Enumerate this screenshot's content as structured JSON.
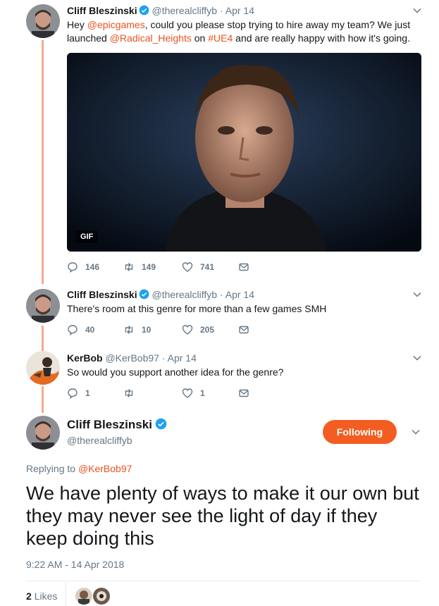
{
  "tweet1": {
    "name": "Cliff Bleszinski",
    "handle": "@therealcliffyb",
    "time": "Apr 14",
    "text_pre": "Hey ",
    "mention1": "@epicgames",
    "text_mid1": ", could you please stop trying to hire away my team? We just launched ",
    "mention2": "@Radical_Heights",
    "text_mid2": " on ",
    "hashtag": "#UE4",
    "text_post": " and are really happy with how it's going.",
    "media_badge": "GIF",
    "replies": "146",
    "retweets": "149",
    "likes": "741"
  },
  "tweet2": {
    "name": "Cliff Bleszinski",
    "handle": "@therealcliffyb",
    "time": "Apr 14",
    "text": "There's room at this genre for more than a few games SMH",
    "replies": "40",
    "retweets": "10",
    "likes": "205"
  },
  "tweet3": {
    "name": "KerBob",
    "handle": "@KerBob97",
    "time": "Apr 14",
    "text": "So would you support another idea for the genre?",
    "replies": "1",
    "retweets": "",
    "likes": "1"
  },
  "main": {
    "name": "Cliff Bleszinski",
    "handle": "@therealcliffyb",
    "follow_label": "Following",
    "replying_prefix": "Replying to ",
    "replying_to": "@KerBob97",
    "text": "We have plenty of ways to make it our own but they may never see the light of day if they keep doing this",
    "timestamp": "9:22 AM - 14 Apr 2018",
    "likes_count": "2",
    "likes_label": "Likes"
  },
  "colors": {
    "accent": "#f45d22",
    "mention": "#e0245e",
    "thread_line": "#f4aa8f",
    "verified": "#1da1f2",
    "muted": "#657786"
  }
}
